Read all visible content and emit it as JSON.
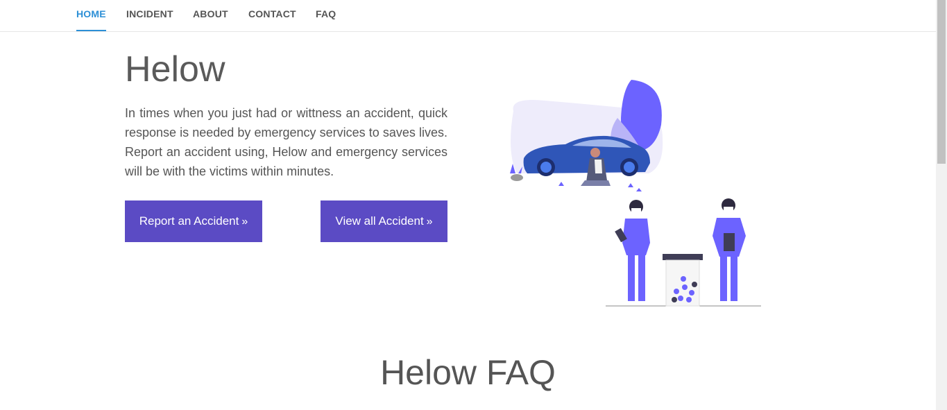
{
  "nav": {
    "items": [
      {
        "label": "HOME",
        "active": true
      },
      {
        "label": "INCIDENT",
        "active": false
      },
      {
        "label": "ABOUT",
        "active": false
      },
      {
        "label": "CONTACT",
        "active": false
      },
      {
        "label": "FAQ",
        "active": false
      }
    ]
  },
  "hero": {
    "title": "Helow",
    "text": "In times when you just had or wittness an accident, quick response is needed by emergency services to saves lives. Report an accident using, Helow and emergency services will be with the victims within minutes.",
    "report_button": "Report an Accident",
    "view_button": "View all Accident",
    "button_chevron": "»"
  },
  "faq": {
    "title": "Helow FAQ"
  },
  "colors": {
    "accent": "#2c8fd6",
    "button": "#5b4bc4",
    "illustration": "#6c63ff"
  }
}
